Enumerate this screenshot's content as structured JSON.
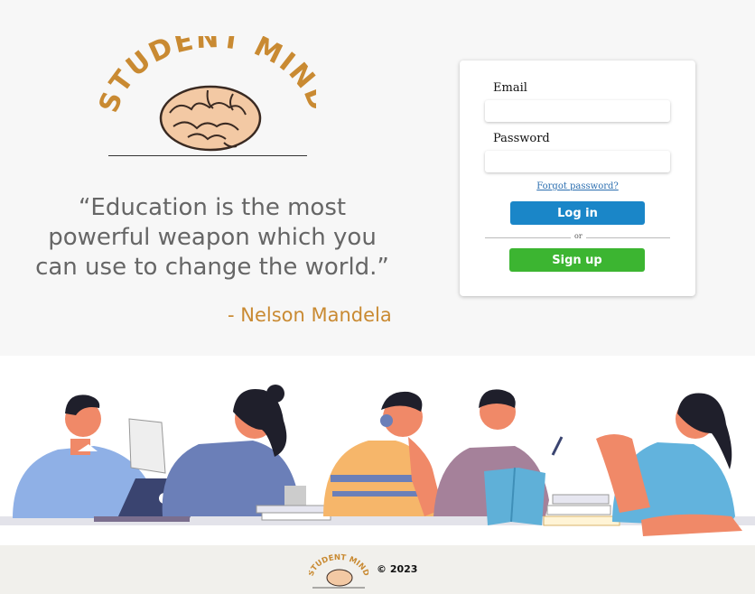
{
  "logo": {
    "text": "STUDENT MIND"
  },
  "quote": {
    "line1": "“Education is the most",
    "line2": "powerful weapon which you",
    "line3": "can use to change the world.”",
    "author": "- Nelson Mandela"
  },
  "login": {
    "email_label": "Email",
    "email_value": "",
    "password_label": "Password",
    "password_value": "",
    "forgot_label": "Forgot password?",
    "login_label": "Log in",
    "or_label": "or",
    "signup_label": "Sign up"
  },
  "footer": {
    "logo_text": "STUDENT MIND",
    "copyright": "©  2023"
  },
  "colors": {
    "brand": "#c98a32",
    "login_button": "#1a86c8",
    "signup_button": "#3cb531",
    "link": "#2c6fb0"
  }
}
